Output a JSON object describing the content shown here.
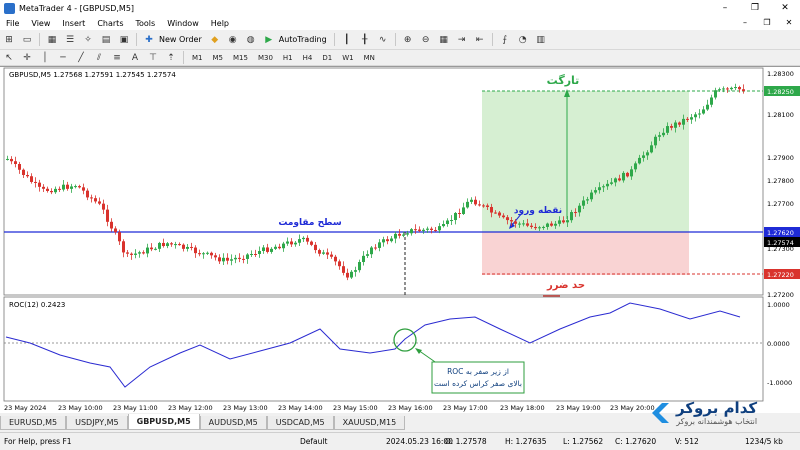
{
  "window": {
    "title": "MetaTrader 4 - [GBPUSD,M5]",
    "controls": [
      "–",
      "❐",
      "✕"
    ]
  },
  "menu": [
    "File",
    "View",
    "Insert",
    "Charts",
    "Tools",
    "Window",
    "Help"
  ],
  "toolbar": {
    "new_order": "New Order",
    "autotrading": "AutoTrading"
  },
  "timeframes": [
    "M1",
    "M5",
    "M15",
    "M30",
    "H1",
    "H4",
    "D1",
    "W1",
    "MN"
  ],
  "chart": {
    "header": "GBPUSD,M5  1.27568 1.27591 1.27545 1.27574",
    "price_labels": [
      "1.28300",
      "1.28250",
      "1.28100",
      "1.27900",
      "1.27800",
      "1.27700",
      "1.27620",
      "1.27574",
      "1.27300",
      "1.27220",
      "1.27200"
    ],
    "current_price": "1.27574",
    "entry_price": "1.27620",
    "target_price": "1.28250",
    "stop_price": "1.27220",
    "annotations": {
      "target": "تارگت",
      "resistance": "سطح مقاومت",
      "entry": "نقطه ورود",
      "stop": "حد ضرر"
    }
  },
  "indicator": {
    "header": "ROC(12)  0.2423",
    "levels": [
      "1.0000",
      "0.0000",
      "-1.0000"
    ],
    "callout_line1": "ROC از زیر صفر به",
    "callout_line2": "بالای صفر کراس کرده است"
  },
  "time_axis": [
    "23 May 2024",
    "23 May 10:00",
    "23 May 11:00",
    "23 May 12:00",
    "23 May 13:00",
    "23 May 14:00",
    "23 May 15:00",
    "23 May 16:00",
    "23 May 17:00",
    "23 May 18:00",
    "23 May 19:00",
    "23 May 20:00"
  ],
  "tabs": [
    "EURUSD,M5",
    "USDJPY,M5",
    "GBPUSD,M5",
    "AUDUSD,M5",
    "USDCAD,M5",
    "XAUUSD,M15"
  ],
  "active_tab": "GBPUSD,M5",
  "status": {
    "help": "For Help, press F1",
    "profile": "Default",
    "datetime": "2024.05.23 16:00",
    "open": "O: 1.27578",
    "high": "H: 1.27635",
    "low": "L: 1.27562",
    "close": "C: 1.27620",
    "volume": "V: 512",
    "traffic": "1234/5 kb"
  },
  "logo": {
    "name": "کدام بروکر",
    "tagline": "انتخاب هوشمندانه بروکر"
  },
  "colors": {
    "bull": "#2ea84a",
    "bear": "#d9332d",
    "resistance": "#1f2bd6",
    "target_zone": "#d6efd2",
    "stop_zone": "#f9d3d3",
    "roc_line": "#2b2bd1",
    "circle": "#2e9e3e"
  }
}
